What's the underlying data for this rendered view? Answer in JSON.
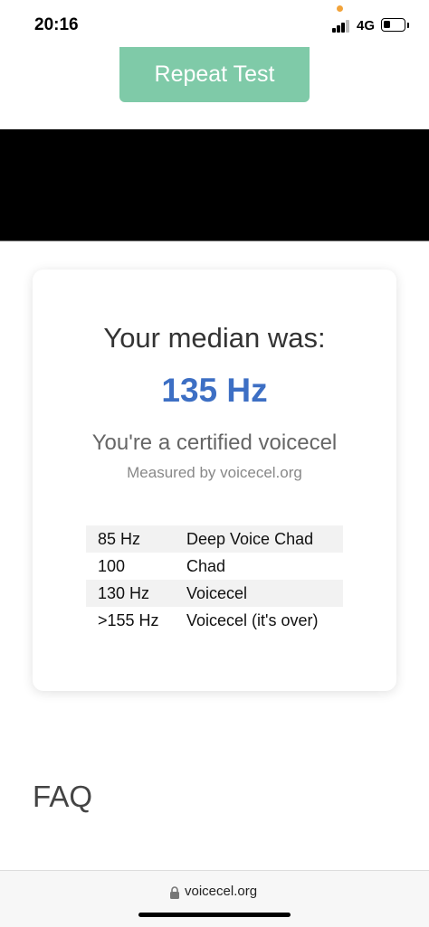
{
  "status_bar": {
    "time": "20:16",
    "network": "4G",
    "battery_level": 0.35,
    "signal_bars": 3
  },
  "actions": {
    "repeat_label": "Repeat Test"
  },
  "result": {
    "median_label": "Your median was:",
    "median_value": "135 Hz",
    "verdict": "You're a certified voicecel",
    "measured_by": "Measured by voicecel.org"
  },
  "ranges": [
    {
      "freq": "85 Hz",
      "label": "Deep Voice Chad"
    },
    {
      "freq": "100",
      "label": "Chad"
    },
    {
      "freq": "130 Hz",
      "label": "Voicecel"
    },
    {
      "freq": ">155 Hz",
      "label": "Voicecel (it's over)"
    }
  ],
  "faq": {
    "heading": "FAQ"
  },
  "browser": {
    "url": "voicecel.org"
  },
  "colors": {
    "accent_green": "#7fcaa8",
    "median_blue": "#3d6fc4"
  }
}
